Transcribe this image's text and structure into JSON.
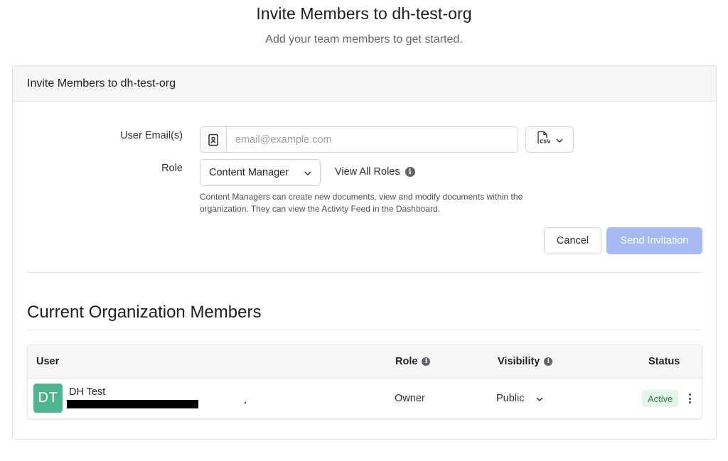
{
  "page": {
    "title": "Invite Members to dh-test-org",
    "subtitle": "Add your team members to get started."
  },
  "invite_card": {
    "header": "Invite Members to dh-test-org",
    "email_label": "User Email(s)",
    "email_placeholder": "email@example.com",
    "email_value": "",
    "csv_icon": "csv-file-icon",
    "role_label": "Role",
    "role_selected": "Content Manager",
    "view_all_roles": "View All Roles",
    "role_help": "Content Managers can create new documents, view and modify documents within the organization. They can view the Activity Feed in the Dashboard.",
    "cancel_label": "Cancel",
    "send_label": "Send Invitation"
  },
  "members": {
    "title": "Current Organization Members",
    "columns": {
      "user": "User",
      "role": "Role",
      "visibility": "Visibility",
      "status": "Status"
    },
    "rows": [
      {
        "initials": "DT",
        "name": "DH Test",
        "role": "Owner",
        "visibility": "Public",
        "status": "Active"
      }
    ]
  },
  "colors": {
    "send_button_disabled": "#a7b9f3",
    "avatar_bg": "#4fb58f",
    "status_active_bg": "#e3f5e8",
    "status_active_text": "#2e7d45"
  }
}
